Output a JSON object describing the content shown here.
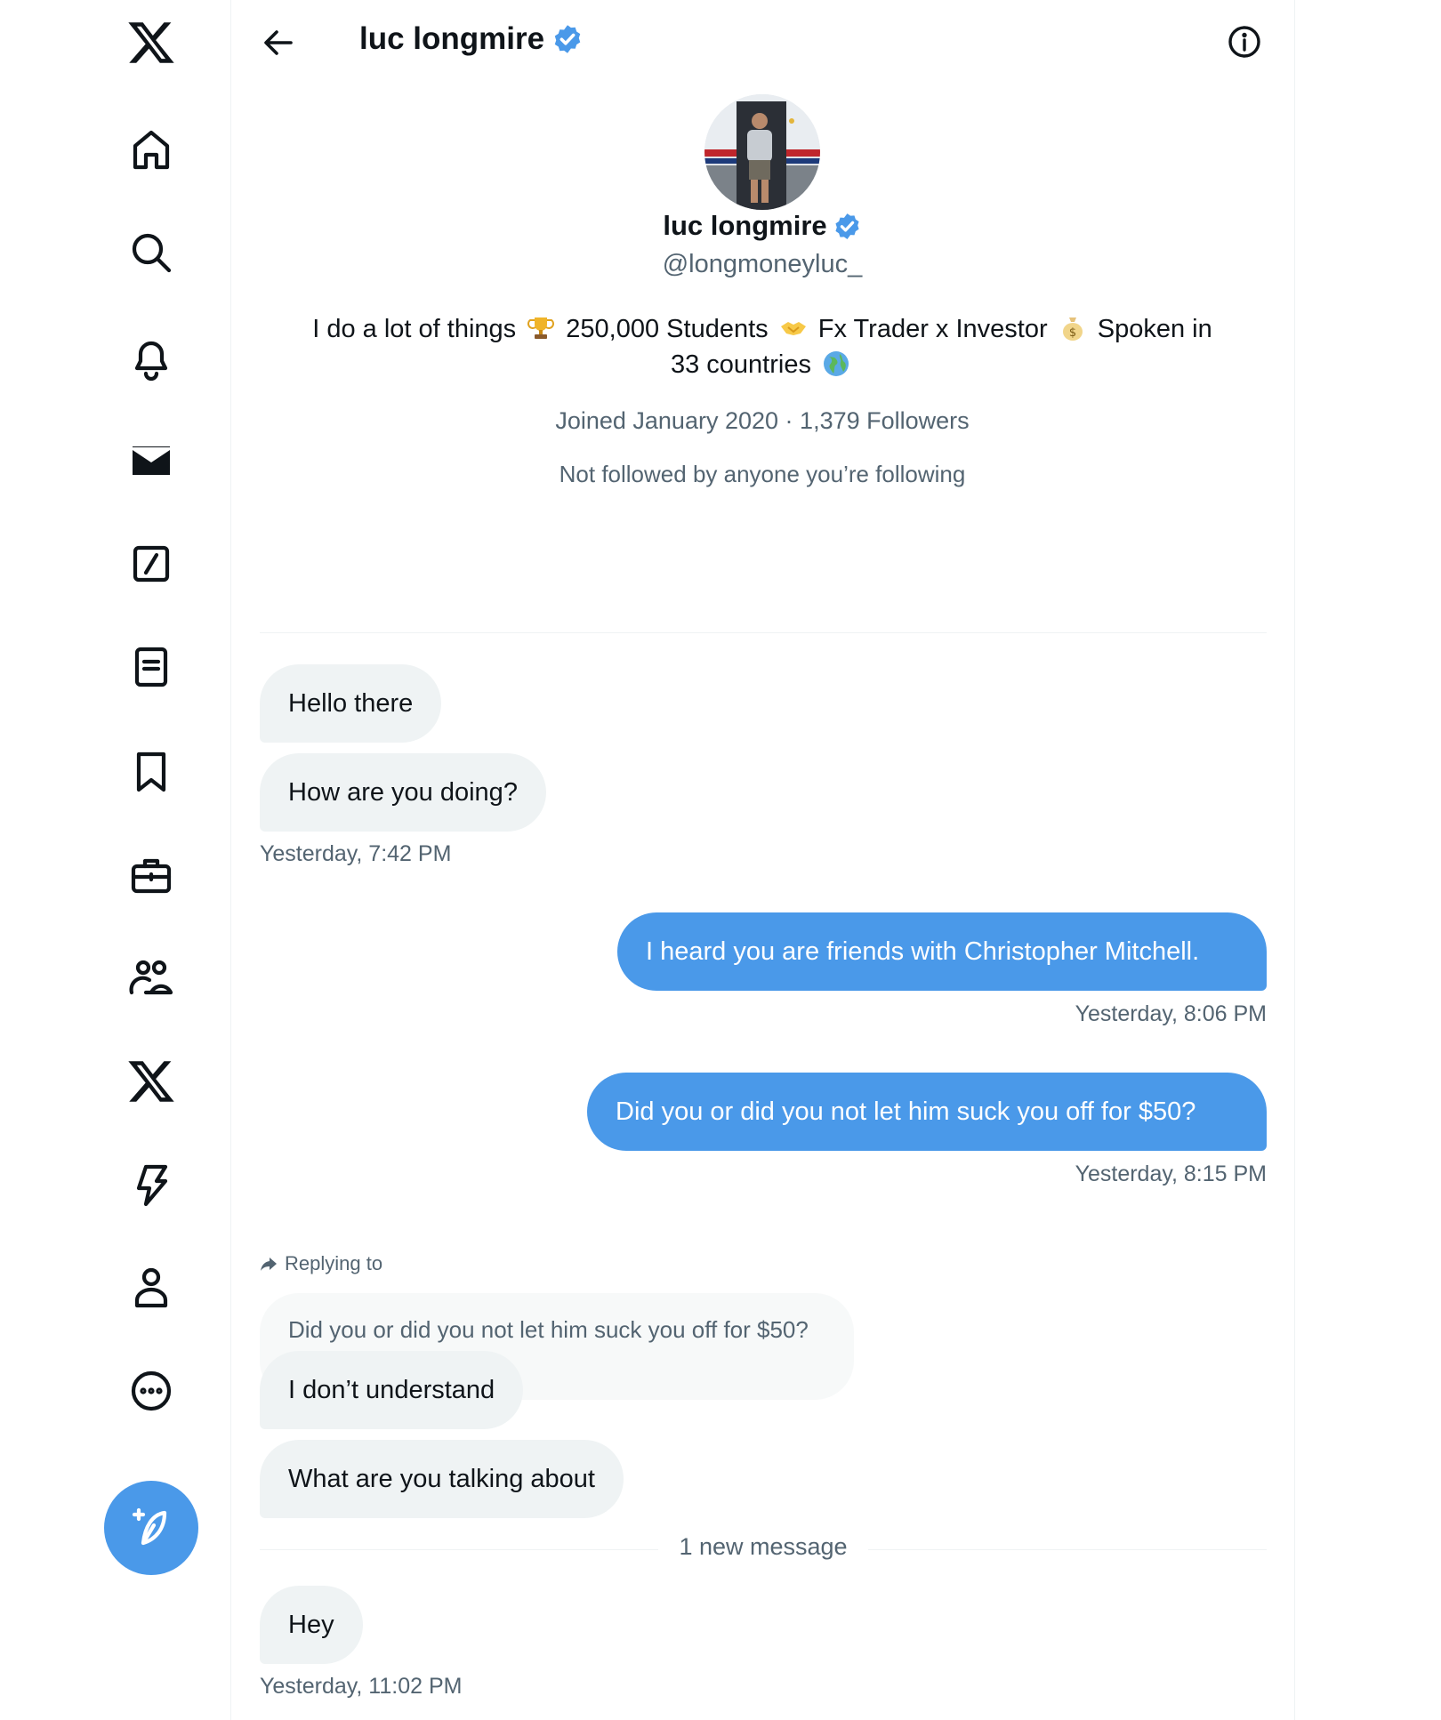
{
  "nav": {
    "items": [
      {
        "icon": "x-logo-icon"
      },
      {
        "icon": "home-icon"
      },
      {
        "icon": "search-icon"
      },
      {
        "icon": "bell-icon"
      },
      {
        "icon": "mail-icon"
      },
      {
        "icon": "grok-icon"
      },
      {
        "icon": "lists-icon"
      },
      {
        "icon": "bookmark-icon"
      },
      {
        "icon": "briefcase-icon"
      },
      {
        "icon": "communities-icon"
      },
      {
        "icon": "x-premium-icon"
      },
      {
        "icon": "verified-orgs-icon"
      },
      {
        "icon": "profile-icon"
      },
      {
        "icon": "more-icon"
      }
    ],
    "compose_icon": "compose-icon"
  },
  "header": {
    "title": "luc longmire",
    "back_icon": "arrow-left-icon",
    "info_icon": "info-icon"
  },
  "profile": {
    "name": "luc longmire",
    "handle": "@longmoneyluc_",
    "bio_1": "I do a lot of things",
    "bio_2": "250,000 Students",
    "bio_3": "Fx Trader x Investor",
    "bio_4": "Spoken in",
    "bio_5": "33 countries",
    "joined": "Joined January 2020",
    "separator": "·",
    "followers": "1,379 Followers",
    "followed_by": "Not followed by anyone you’re following"
  },
  "messages": [
    {
      "text": "Hello there",
      "direction": "received"
    },
    {
      "text": "How are you doing?",
      "direction": "received"
    },
    {
      "text": "I heard you are friends with Christopher Mitchell.",
      "direction": "sent"
    },
    {
      "text": "Did you or did you not let him suck you off for $50?",
      "direction": "sent"
    },
    {
      "text": "I don’t understand",
      "direction": "received"
    },
    {
      "text": "What are you talking about",
      "direction": "received"
    },
    {
      "text": "Hey",
      "direction": "received"
    }
  ],
  "timestamps": [
    "Yesterday, 7:42 PM",
    "Yesterday, 8:06 PM",
    "Yesterday, 8:15 PM",
    "Yesterday, 11:02 PM"
  ],
  "reply": {
    "label": "Replying to",
    "quoted_text": "Did you or did you not let him suck you off for $50?"
  },
  "new_message_divider": "1 new message",
  "colors": {
    "accent": "#4a99e9",
    "received_bubble": "#eff3f4",
    "secondary_text": "#536471"
  }
}
